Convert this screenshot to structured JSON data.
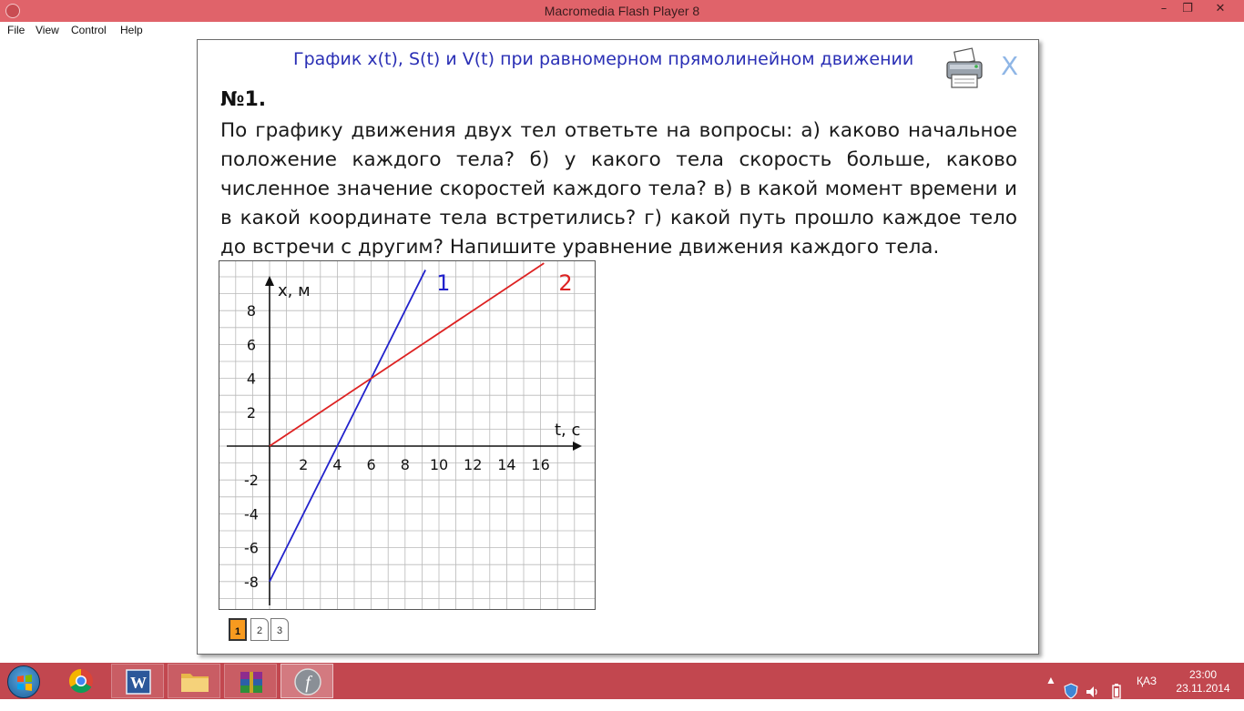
{
  "window": {
    "title": "Macromedia Flash Player 8",
    "minimize": "–",
    "restore": "❐",
    "close": "✕"
  },
  "menu": [
    "File",
    "View",
    "Control",
    "Help"
  ],
  "content": {
    "heading": "График x(t), S(t) и V(t) при равномерном прямолинейном движении",
    "close_label": "X",
    "task_number": "№1.",
    "task_text": "По графику движения двух тел ответьте на вопросы: а) каково начальное положение каждого тела? б) у какого тела скорость больше, каково численное значение скоростей каждого тела? в) в какой момент времени и в какой координате тела встретились? г) какой путь прошло каждое тело до встречи с другим? Напишите уравнение движения каждого тела.",
    "pages": [
      "1",
      "2",
      "3"
    ],
    "active_page": "1"
  },
  "chart_data": {
    "type": "line",
    "xlabel": "t, c",
    "ylabel": "x, м",
    "xlim": [
      -3,
      18.5
    ],
    "ylim": [
      -10,
      11
    ],
    "x_ticks": [
      "2",
      "4",
      "6",
      "8",
      "10",
      "12",
      "14",
      "16"
    ],
    "y_ticks": [
      "8",
      "6",
      "4",
      "2",
      "-2",
      "-4",
      "-6",
      "-8"
    ],
    "grid": true,
    "series": [
      {
        "name": "1",
        "color": "#2222cc",
        "x": [
          0,
          9.2
        ],
        "y": [
          -8,
          10.4
        ]
      },
      {
        "name": "2",
        "color": "#dd2222",
        "x": [
          0,
          16.2
        ],
        "y": [
          0,
          10.8
        ]
      }
    ]
  },
  "taskbar": {
    "apps": [
      "start-orb",
      "chrome",
      "word",
      "file-explorer",
      "winrar",
      "flash-player"
    ],
    "language": "ҚАЗ",
    "time": "23:00",
    "date": "23.11.2014",
    "tray_arrow": "▲"
  },
  "colors": {
    "titlebar": "#e0636a",
    "taskbar": "#c2474f",
    "heading": "#2a2fb5",
    "series1": "#2222cc",
    "series2": "#dd2222",
    "active_page": "#f79a1f"
  }
}
